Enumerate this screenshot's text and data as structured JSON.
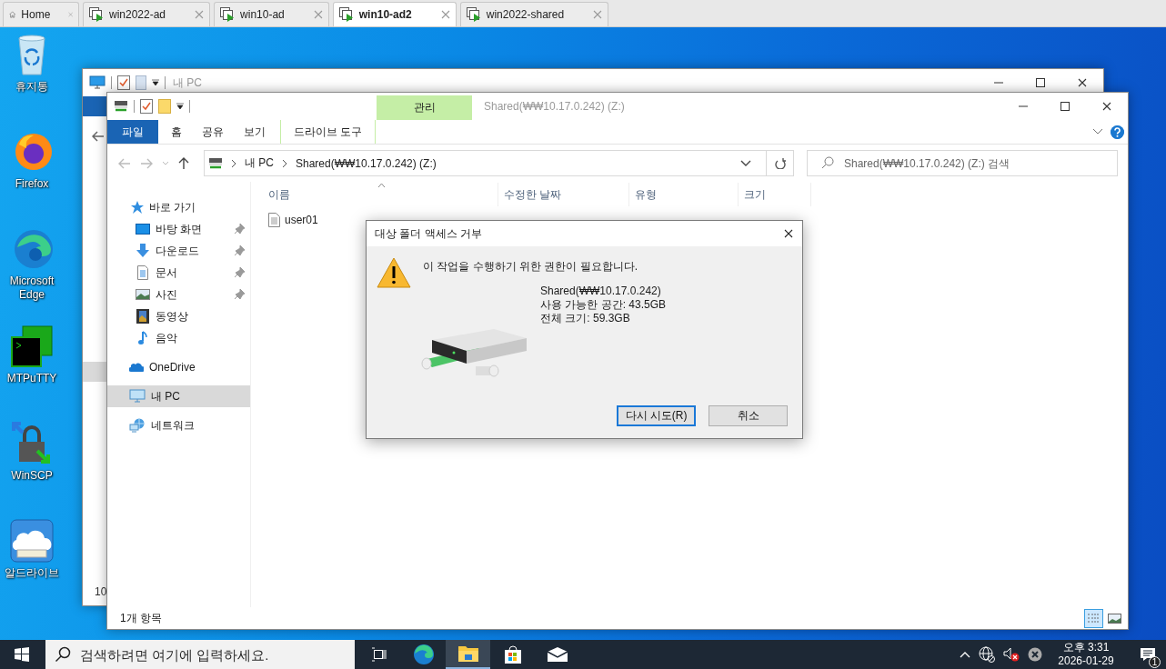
{
  "host_tabs": [
    {
      "label": "Home",
      "kind": "home",
      "selected": false
    },
    {
      "label": "win2022-ad",
      "kind": "vm",
      "selected": false
    },
    {
      "label": "win10-ad",
      "kind": "vm",
      "selected": false
    },
    {
      "label": "win10-ad2",
      "kind": "vm",
      "selected": true
    },
    {
      "label": "win2022-shared",
      "kind": "vm",
      "selected": false
    }
  ],
  "desktop_icons": [
    {
      "label": "휴지통",
      "kind": "recycle"
    },
    {
      "label": "Firefox",
      "kind": "firefox"
    },
    {
      "label": "Microsoft Edge",
      "kind": "edge"
    },
    {
      "label": "MTPuTTY",
      "kind": "terminal"
    },
    {
      "label": "WinSCP",
      "kind": "winscp"
    },
    {
      "label": "알드라이브",
      "kind": "cloud-drive"
    }
  ],
  "back_window": {
    "title": "내 PC",
    "status": "10"
  },
  "window": {
    "title": "Shared(₩₩10.17.0.242) (Z:)",
    "context_tab": "관리",
    "ribbon_tabs": [
      {
        "label": "파일",
        "kind": "file"
      },
      {
        "label": "홈",
        "kind": "normal"
      },
      {
        "label": "공유",
        "kind": "normal"
      },
      {
        "label": "보기",
        "kind": "normal"
      },
      {
        "label": "드라이브 도구",
        "kind": "context"
      }
    ],
    "breadcrumbs": [
      "내 PC",
      "Shared(₩₩10.17.0.242) (Z:)"
    ],
    "search": {
      "placeholder": "Shared(₩₩10.17.0.242) (Z:) 검색"
    },
    "nav": [
      {
        "label": "바로 가기",
        "kind": "star",
        "selected": false,
        "children": [
          {
            "label": "바탕 화면",
            "kind": "desktop",
            "pinned": true,
            "selected": false
          },
          {
            "label": "다운로드",
            "kind": "download",
            "pinned": true,
            "selected": false
          },
          {
            "label": "문서",
            "kind": "document",
            "pinned": true,
            "selected": false
          },
          {
            "label": "사진",
            "kind": "pictures",
            "pinned": true,
            "selected": false
          },
          {
            "label": "동영상",
            "kind": "video",
            "pinned": false,
            "selected": false
          },
          {
            "label": "음악",
            "kind": "music",
            "pinned": false,
            "selected": false
          }
        ]
      },
      {
        "label": "OneDrive",
        "kind": "cloud",
        "selected": false
      },
      {
        "label": "내 PC",
        "kind": "pc",
        "selected": true
      },
      {
        "label": "네트워크",
        "kind": "network",
        "selected": false
      }
    ],
    "columns": [
      {
        "label": "이름",
        "sorted": true
      },
      {
        "label": "수정한 날짜",
        "sorted": false
      },
      {
        "label": "유형",
        "sorted": false
      },
      {
        "label": "크기",
        "sorted": false
      }
    ],
    "files": [
      {
        "name": "user01"
      }
    ],
    "status_bar": {
      "count": "1개 항목",
      "views": [
        {
          "kind": "details",
          "selected": true
        },
        {
          "kind": "large",
          "selected": false
        }
      ]
    }
  },
  "dialog": {
    "title": "대상 폴더 액세스 거부",
    "message": "이 작업을 수행하기 위한 권한이 필요합니다.",
    "details": [
      "Shared(₩₩10.17.0.242)",
      "사용 가능한 공간: 43.5GB",
      "전체 크기: 59.3GB"
    ],
    "buttons": [
      {
        "label": "다시 시도(R)",
        "default": true
      },
      {
        "label": "취소",
        "default": false
      }
    ]
  },
  "taskbar": {
    "search": {
      "placeholder": "검색하려면 여기에 입력하세요."
    },
    "apps": [
      {
        "kind": "taskview",
        "active": false
      },
      {
        "kind": "edge",
        "active": false
      },
      {
        "kind": "explorer",
        "active": true
      },
      {
        "kind": "store",
        "active": false
      },
      {
        "kind": "mail",
        "active": false
      }
    ],
    "clock": {
      "time": "오후 3:31",
      "date": "2026-01-29"
    },
    "notifications": "1"
  }
}
